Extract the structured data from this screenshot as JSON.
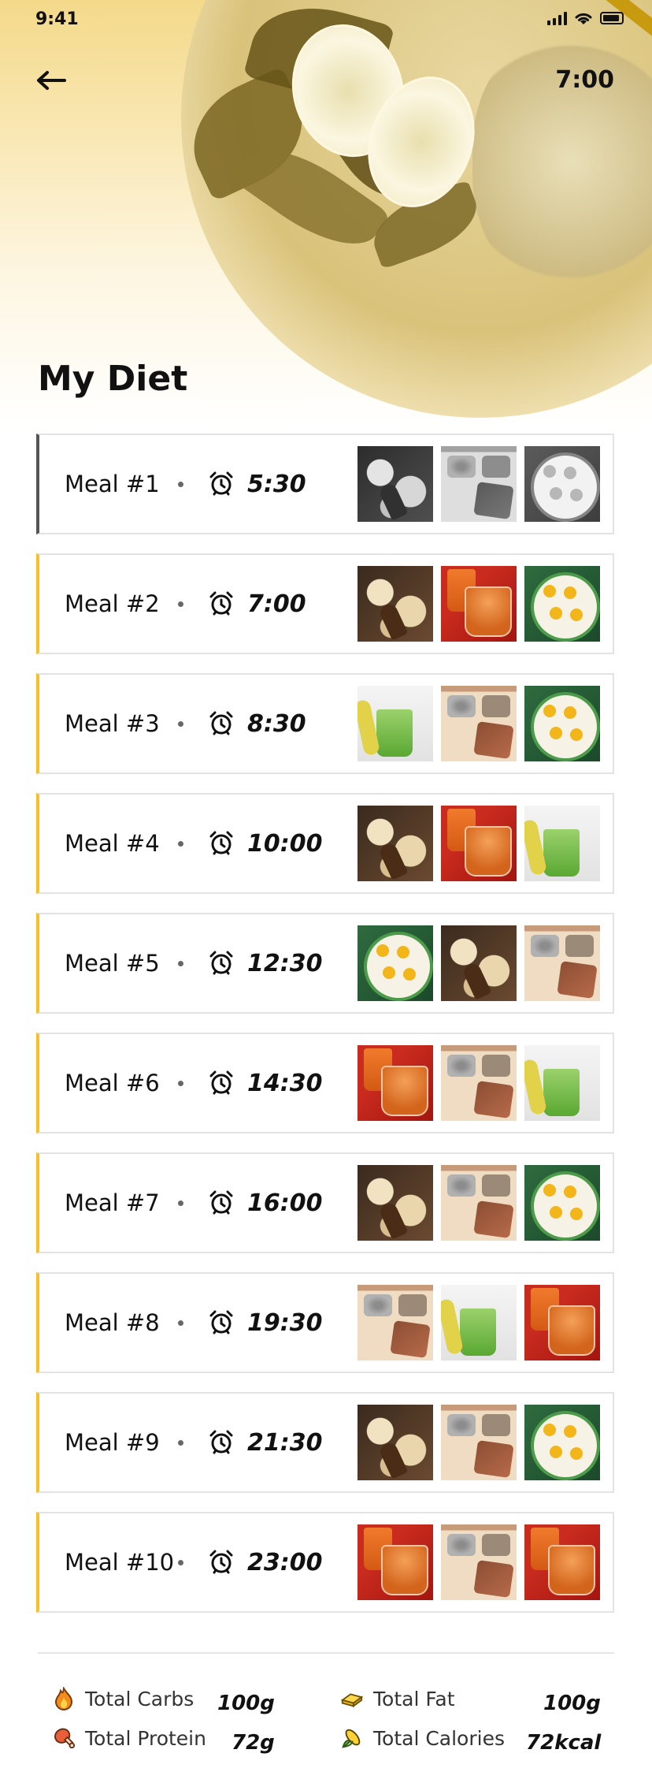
{
  "status_bar": {
    "time": "9:41"
  },
  "header": {
    "timer": "7:00",
    "title": "My Diet"
  },
  "meals": [
    {
      "name": "Meal #1",
      "time": "5:30",
      "state": "active",
      "thumbs": [
        "oats",
        "seeds",
        "eggs"
      ]
    },
    {
      "name": "Meal #2",
      "time": "7:00",
      "state": "upcoming",
      "thumbs": [
        "oats",
        "tea",
        "eggs"
      ]
    },
    {
      "name": "Meal #3",
      "time": "8:30",
      "state": "upcoming",
      "thumbs": [
        "juice",
        "seeds",
        "eggs"
      ]
    },
    {
      "name": "Meal #4",
      "time": "10:00",
      "state": "upcoming",
      "thumbs": [
        "oats",
        "tea",
        "juice"
      ]
    },
    {
      "name": "Meal #5",
      "time": "12:30",
      "state": "upcoming",
      "thumbs": [
        "eggs",
        "oats",
        "seeds"
      ]
    },
    {
      "name": "Meal #6",
      "time": "14:30",
      "state": "upcoming",
      "thumbs": [
        "tea",
        "seeds",
        "juice"
      ]
    },
    {
      "name": "Meal #7",
      "time": "16:00",
      "state": "upcoming",
      "thumbs": [
        "oats",
        "seeds",
        "eggs"
      ]
    },
    {
      "name": "Meal #8",
      "time": "19:30",
      "state": "upcoming",
      "thumbs": [
        "seeds",
        "juice",
        "tea"
      ]
    },
    {
      "name": "Meal #9",
      "time": "21:30",
      "state": "upcoming",
      "thumbs": [
        "oats",
        "seeds",
        "eggs"
      ]
    },
    {
      "name": "Meal #10",
      "time": "23:00",
      "state": "upcoming",
      "thumbs": [
        "tea",
        "seeds",
        "tea"
      ]
    }
  ],
  "totals": {
    "carbs": {
      "label": "Total Carbs",
      "value": "100g",
      "icon": "flame-icon"
    },
    "fat": {
      "label": "Total Fat",
      "value": "100g",
      "icon": "butter-icon"
    },
    "protein": {
      "label": "Total Protein",
      "value": "72g",
      "icon": "meat-icon"
    },
    "calories": {
      "label": "Total Calories",
      "value": "72kcal",
      "icon": "corn-icon"
    }
  },
  "colors": {
    "accent": "#f7c02b",
    "active_border": "#555555",
    "card_border": "#e3e3e3"
  }
}
